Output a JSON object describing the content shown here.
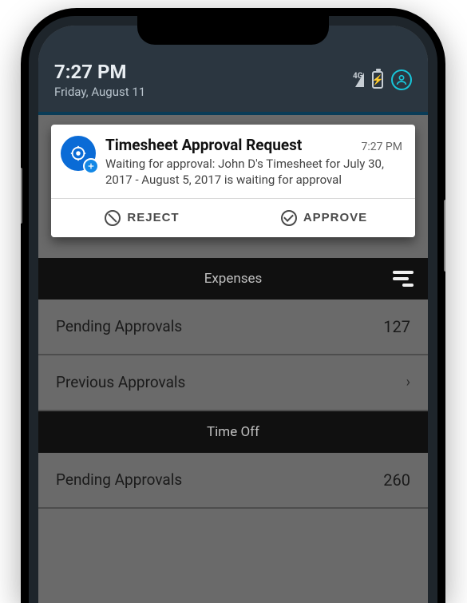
{
  "status": {
    "time": "7:27 PM",
    "date": "Friday, August 11",
    "signal_label": "4G",
    "battery_glyph": "⚡"
  },
  "notification": {
    "title": "Timesheet Approval Request",
    "time": "7:27 PM",
    "message": "Waiting for approval: John D's Timesheet for July 30, 2017 - August 5, 2017 is waiting for approval",
    "reject_label": "REJECT",
    "approve_label": "APPROVE"
  },
  "sections": {
    "expenses": {
      "header": "Expenses",
      "pending_label": "Pending Approvals",
      "pending_count": "127",
      "previous_label": "Previous Approvals"
    },
    "timeoff": {
      "header": "Time Off",
      "pending_label": "Pending Approvals",
      "pending_count": "260"
    }
  }
}
